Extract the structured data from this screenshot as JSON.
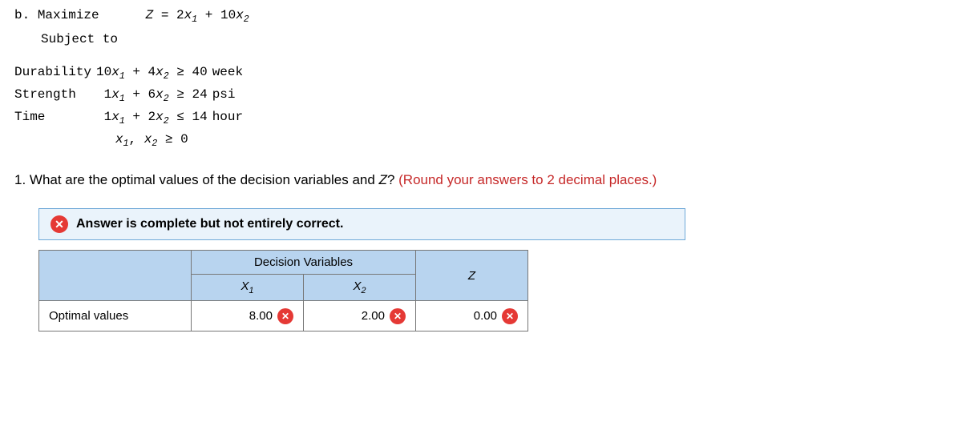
{
  "header": {
    "part_label": "b.",
    "maximize": "Maximize",
    "objective": "Z = 2x1 + 10x2",
    "subject_to": "Subject to"
  },
  "constraints": {
    "rows": [
      {
        "label": "Durability",
        "expr": "10x1 + 4x2 ≥ 40",
        "unit": "week"
      },
      {
        "label": "Strength",
        "expr": "1x1 + 6x2 ≥ 24",
        "unit": "psi"
      },
      {
        "label": "Time",
        "expr": "1x1 + 2x2 ≤ 14",
        "unit": "hour"
      }
    ],
    "nonneg": "x1, x2 ≥ 0"
  },
  "question": {
    "prefix": "1. What are the optimal values of the decision variables and ",
    "zvar": "Z",
    "suffix": "? ",
    "hint": "(Round your answers to 2 decimal places.)"
  },
  "feedback": {
    "message": "Answer is complete but not entirely correct."
  },
  "table": {
    "group_header": "Decision Variables",
    "col_x1": "X1",
    "col_x2": "X2",
    "col_z": "Z",
    "row_label": "Optimal values",
    "values": {
      "x1": "8.00",
      "x2": "2.00",
      "z": "0.00"
    }
  },
  "icons": {
    "cross": "✕"
  }
}
